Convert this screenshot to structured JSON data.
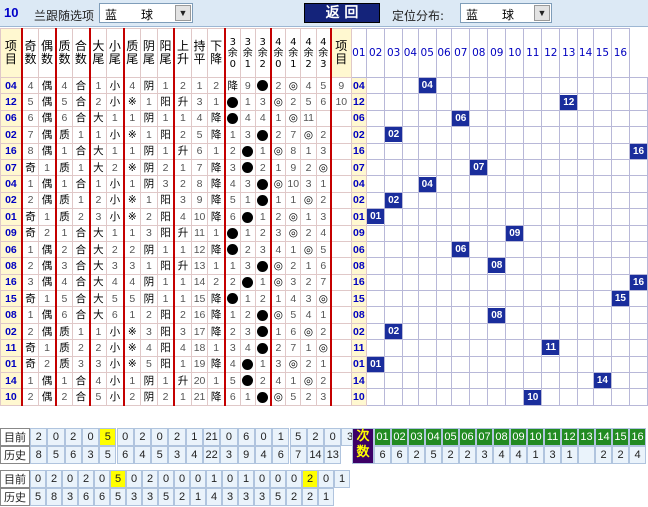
{
  "top": {
    "issue_no": "10",
    "filter_label": "兰跟随选项",
    "filter_value": "蓝　　球",
    "back_label": "返 回",
    "dist_label": "定位分布:",
    "dist_value": "蓝　　球"
  },
  "headers": [
    "项目",
    "奇数",
    "偶数",
    "质数",
    "合数",
    "大尾",
    "小尾",
    "质尾",
    "阴尾",
    "阳尾",
    "上升",
    "持平",
    "下降",
    "3余0",
    "3余1",
    "3余2",
    "4余0",
    "4余1",
    "4余2",
    "4余3",
    "项目"
  ],
  "dist_headers": [
    "01",
    "02",
    "03",
    "04",
    "05",
    "06",
    "07",
    "08",
    "09",
    "10",
    "11",
    "12",
    "13",
    "14",
    "15",
    "16"
  ],
  "rows": [
    {
      "id": "04",
      "c": [
        "4",
        "偶",
        "4",
        "合",
        "1",
        "小",
        "4",
        "阴",
        "1",
        "2",
        "1",
        "2",
        "降",
        "9",
        "●",
        "2",
        "◎",
        "4",
        "5",
        "9"
      ],
      "hit": 4
    },
    {
      "id": "12",
      "c": [
        "5",
        "偶",
        "5",
        "合",
        "2",
        "小",
        "※",
        "1",
        "阳",
        "升",
        "3",
        "1",
        "●",
        "1",
        "3",
        "◎",
        "2",
        "5",
        "6",
        "10"
      ],
      "hit": 12
    },
    {
      "id": "06",
      "c": [
        "6",
        "偶",
        "6",
        "合",
        "大",
        "1",
        "1",
        "阴",
        "1",
        "1",
        "4",
        "降",
        "●",
        "4",
        "4",
        "1",
        "◎",
        "11",
        "",
        ""
      ],
      "hit": 6
    },
    {
      "id": "02",
      "c": [
        "7",
        "偶",
        "质",
        "1",
        "1",
        "小",
        "※",
        "1",
        "阳",
        "2",
        "5",
        "降",
        "1",
        "3",
        "●",
        "2",
        "7",
        "◎",
        "2",
        ""
      ],
      "hit": 2
    },
    {
      "id": "16",
      "c": [
        "8",
        "偶",
        "1",
        "合",
        "大",
        "1",
        "1",
        "阴",
        "1",
        "升",
        "6",
        "1",
        "2",
        "●",
        "1",
        "◎",
        "8",
        "1",
        "3",
        ""
      ],
      "hit": 16
    },
    {
      "id": "07",
      "c": [
        "奇",
        "1",
        "质",
        "1",
        "大",
        "2",
        "※",
        "阴",
        "2",
        "1",
        "7",
        "降",
        "3",
        "●",
        "2",
        "1",
        "9",
        "2",
        "◎",
        ""
      ],
      "hit": 7
    },
    {
      "id": "04",
      "c": [
        "1",
        "偶",
        "1",
        "合",
        "1",
        "小",
        "1",
        "阴",
        "3",
        "2",
        "8",
        "降",
        "4",
        "3",
        "●",
        "◎",
        "10",
        "3",
        "1",
        ""
      ],
      "hit": 4
    },
    {
      "id": "02",
      "c": [
        "2",
        "偶",
        "质",
        "1",
        "2",
        "小",
        "※",
        "1",
        "阳",
        "3",
        "9",
        "降",
        "5",
        "1",
        "●",
        "1",
        "1",
        "◎",
        "2",
        ""
      ],
      "hit": 2
    },
    {
      "id": "01",
      "c": [
        "奇",
        "1",
        "质",
        "2",
        "3",
        "小",
        "※",
        "2",
        "阳",
        "4",
        "10",
        "降",
        "6",
        "●",
        "1",
        "2",
        "◎",
        "1",
        "3",
        ""
      ],
      "hit": 1
    },
    {
      "id": "09",
      "c": [
        "奇",
        "2",
        "1",
        "合",
        "大",
        "1",
        "1",
        "3",
        "阳",
        "升",
        "11",
        "1",
        "●",
        "1",
        "2",
        "3",
        "◎",
        "2",
        "4",
        ""
      ],
      "hit": 9
    },
    {
      "id": "06",
      "c": [
        "1",
        "偶",
        "2",
        "合",
        "大",
        "2",
        "2",
        "阴",
        "1",
        "1",
        "12",
        "降",
        "●",
        "2",
        "3",
        "4",
        "1",
        "◎",
        "5",
        ""
      ],
      "hit": 6
    },
    {
      "id": "08",
      "c": [
        "2",
        "偶",
        "3",
        "合",
        "大",
        "3",
        "3",
        "1",
        "阳",
        "升",
        "13",
        "1",
        "1",
        "3",
        "●",
        "◎",
        "2",
        "1",
        "6",
        ""
      ],
      "hit": 8
    },
    {
      "id": "16",
      "c": [
        "3",
        "偶",
        "4",
        "合",
        "大",
        "4",
        "4",
        "阴",
        "1",
        "1",
        "14",
        "2",
        "2",
        "●",
        "1",
        "◎",
        "3",
        "2",
        "7",
        ""
      ],
      "hit": 16
    },
    {
      "id": "15",
      "c": [
        "奇",
        "1",
        "5",
        "合",
        "大",
        "5",
        "5",
        "阴",
        "1",
        "1",
        "15",
        "降",
        "●",
        "1",
        "2",
        "1",
        "4",
        "3",
        "◎",
        ""
      ],
      "hit": 15
    },
    {
      "id": "08",
      "c": [
        "1",
        "偶",
        "6",
        "合",
        "大",
        "6",
        "1",
        "2",
        "阳",
        "2",
        "16",
        "降",
        "1",
        "2",
        "●",
        "◎",
        "5",
        "4",
        "1",
        ""
      ],
      "hit": 8
    },
    {
      "id": "02",
      "c": [
        "2",
        "偶",
        "质",
        "1",
        "1",
        "小",
        "※",
        "3",
        "阳",
        "3",
        "17",
        "降",
        "2",
        "3",
        "●",
        "1",
        "6",
        "◎",
        "2",
        ""
      ],
      "hit": 2
    },
    {
      "id": "11",
      "c": [
        "奇",
        "1",
        "质",
        "2",
        "2",
        "小",
        "※",
        "4",
        "阳",
        "4",
        "18",
        "1",
        "3",
        "4",
        "●",
        "2",
        "7",
        "1",
        "◎",
        ""
      ],
      "hit": 11
    },
    {
      "id": "01",
      "c": [
        "奇",
        "2",
        "质",
        "3",
        "3",
        "小",
        "※",
        "5",
        "阳",
        "1",
        "19",
        "降",
        "4",
        "●",
        "1",
        "3",
        "◎",
        "2",
        "1",
        ""
      ],
      "hit": 1
    },
    {
      "id": "14",
      "c": [
        "1",
        "偶",
        "1",
        "合",
        "4",
        "小",
        "1",
        "阴",
        "1",
        "升",
        "20",
        "1",
        "5",
        "●",
        "2",
        "4",
        "1",
        "◎",
        "2",
        ""
      ],
      "hit": 14
    },
    {
      "id": "10",
      "c": [
        "2",
        "偶",
        "2",
        "合",
        "5",
        "小",
        "2",
        "阴",
        "2",
        "1",
        "21",
        "降",
        "6",
        "1",
        "●",
        "◎",
        "5",
        "2",
        "3",
        ""
      ],
      "hit": 10
    }
  ],
  "bottom": {
    "cur_label": "目前",
    "hist_label": "历史",
    "next_label": "次数",
    "cur": [
      "2",
      "0",
      "2",
      "0",
      "5",
      "0",
      "2",
      "0",
      "2",
      "1",
      "21",
      "0",
      "6",
      "0",
      "1",
      "5",
      "2",
      "0",
      "3"
    ],
    "hist": [
      "8",
      "5",
      "6",
      "3",
      "5",
      "6",
      "4",
      "5",
      "3",
      "4",
      "22",
      "3",
      "9",
      "4",
      "6",
      "7",
      "14",
      "13"
    ],
    "next_nums": [
      "01",
      "02",
      "03",
      "04",
      "05",
      "06",
      "07",
      "08",
      "09",
      "10",
      "11",
      "12",
      "13",
      "14",
      "15",
      "16"
    ],
    "next_vals": [
      "6",
      "6",
      "2",
      "5",
      "2",
      "2",
      "3",
      "4",
      "4",
      "1",
      "3",
      "1",
      "",
      "2",
      "2",
      "4"
    ],
    "cur2": [
      "0",
      "2",
      "0",
      "2",
      "0",
      "5",
      "0",
      "2",
      "0",
      "0",
      "0",
      "1",
      "0",
      "1",
      "0",
      "0",
      "0",
      "2",
      "0",
      "1"
    ],
    "hist2": [
      "5",
      "8",
      "3",
      "6",
      "6",
      "5",
      "3",
      "3",
      "5",
      "2",
      "1",
      "4",
      "3",
      "3",
      "3",
      "5",
      "2",
      "2",
      "1"
    ]
  }
}
